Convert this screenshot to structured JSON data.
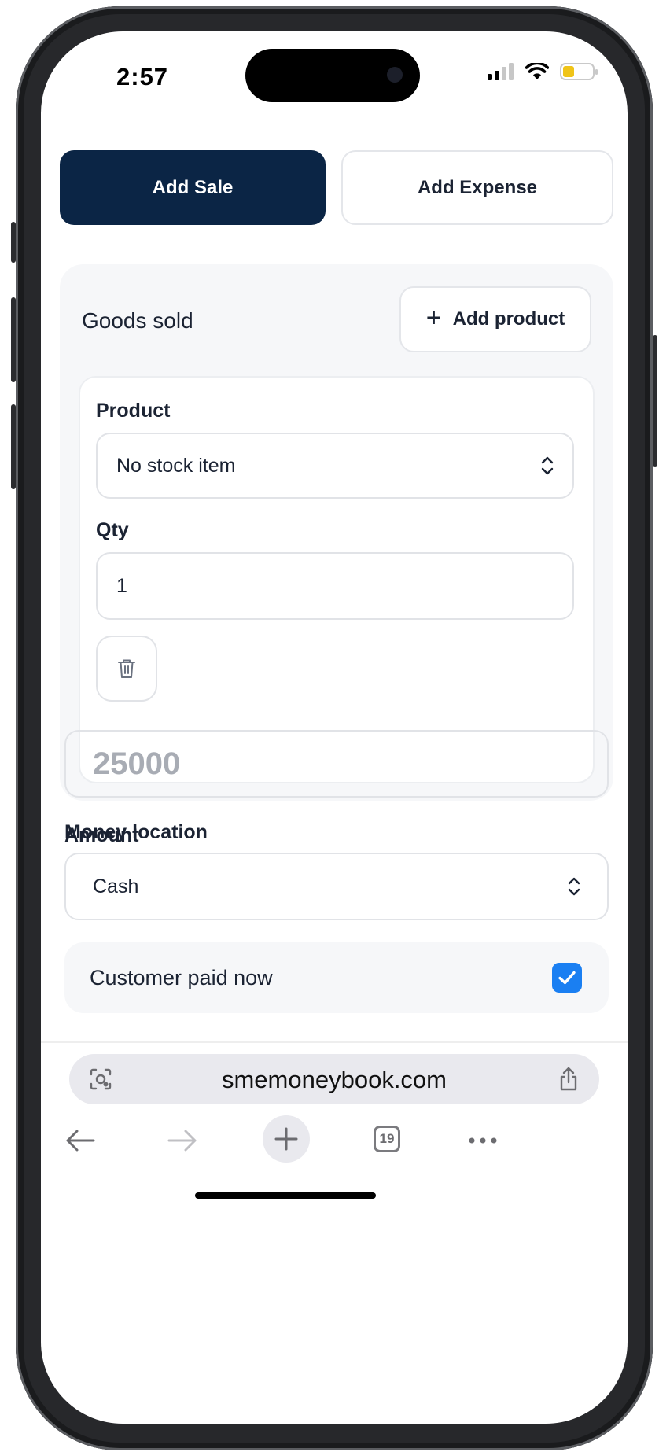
{
  "status": {
    "time": "2:57"
  },
  "tabs": {
    "sale": "Add Sale",
    "expense": "Add Expense"
  },
  "goods": {
    "title": "Goods sold",
    "add_product": "Add product",
    "product_label": "Product",
    "product_value": "No stock item",
    "qty_label": "Qty",
    "qty_value": "1"
  },
  "amount": {
    "label": "Amount",
    "placeholder": "25000"
  },
  "money_location": {
    "label": "Money location",
    "value": "Cash"
  },
  "customer_paid": {
    "label": "Customer paid now",
    "checked": true
  },
  "browser": {
    "url": "smemoneybook.com",
    "tab_count": "19"
  },
  "colors": {
    "primary": "#0b2545",
    "checkbox": "#1a7ff2",
    "battery": "#f0c419"
  }
}
